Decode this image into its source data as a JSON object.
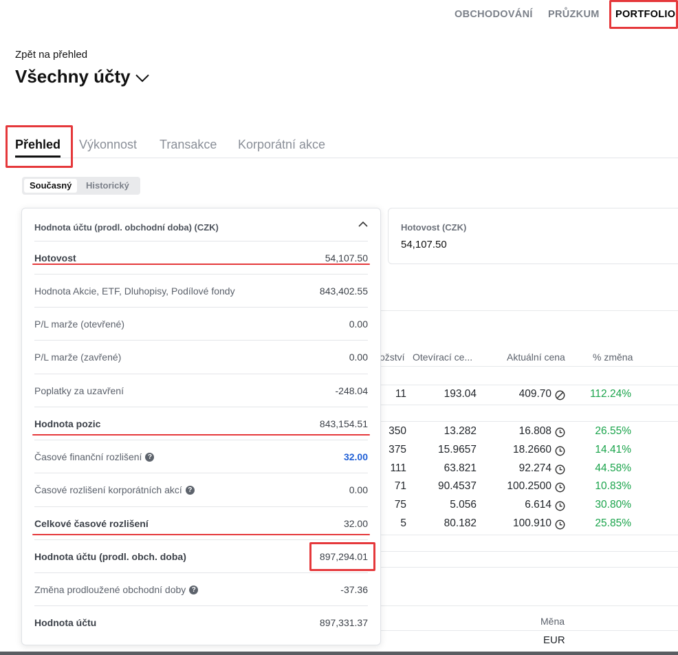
{
  "topnav": {
    "items": [
      {
        "label": "OBCHODOVÁNÍ"
      },
      {
        "label": "PRŮZKUM"
      },
      {
        "label": "PORTFOLIO"
      }
    ]
  },
  "header": {
    "back_link": "Zpět na přehled",
    "title": "Všechny účty"
  },
  "tabs": [
    {
      "label": "Přehled"
    },
    {
      "label": "Výkonnost"
    },
    {
      "label": "Transakce"
    },
    {
      "label": "Korporátní akce"
    }
  ],
  "segment": {
    "current": "Současný",
    "historic": "Historický"
  },
  "cash_card": {
    "label": "Hotovost (CZK)",
    "value": "54,107.50"
  },
  "popover": {
    "title": "Hodnota účtu (prodl. obchodní doba) (CZK)",
    "rows": [
      {
        "label": "Hotovost",
        "value": "54,107.50"
      },
      {
        "label": "Hodnota Akcie, ETF, Dluhopisy, Podílové fondy",
        "value": "843,402.55"
      },
      {
        "label": "P/L marže (otevřené)",
        "value": "0.00"
      },
      {
        "label": "P/L marže (zavřené)",
        "value": "0.00"
      },
      {
        "label": "Poplatky za uzavření",
        "value": "-248.04"
      },
      {
        "label": "Hodnota pozic",
        "value": "843,154.51"
      },
      {
        "label": "Časové finanční rozlišení",
        "value": "32.00"
      },
      {
        "label": "Časové rozlišení korporátních akcí",
        "value": "0.00"
      },
      {
        "label": "Celkové časové rozlišení",
        "value": "32.00"
      },
      {
        "label": "Hodnota účtu (prodl. obch. doba)",
        "value": "897,294.01"
      },
      {
        "label": "Změna prodloužené obchodní doby",
        "value": "-37.36"
      },
      {
        "label": "Hodnota účtu",
        "value": "897,331.37"
      }
    ]
  },
  "positions": {
    "headers": [
      "ožství",
      "Otevírací ce...",
      "Aktuální cena",
      "% změna"
    ],
    "rows": [
      {
        "qty": "11",
        "open": "193.04",
        "current": "409.70",
        "change": "112.24%",
        "status": "blocked-icon"
      },
      {
        "qty": "350",
        "open": "13.282",
        "current": "16.808",
        "change": "26.55%",
        "status": "clock-icon"
      },
      {
        "qty": "375",
        "open": "15.9657",
        "current": "18.2660",
        "change": "14.41%",
        "status": "clock-icon"
      },
      {
        "qty": "111",
        "open": "63.821",
        "current": "92.274",
        "change": "44.58%",
        "status": "clock-icon"
      },
      {
        "qty": "71",
        "open": "90.4537",
        "current": "100.2500",
        "change": "10.83%",
        "status": "clock-icon"
      },
      {
        "qty": "75",
        "open": "5.056",
        "current": "6.614",
        "change": "30.80%",
        "status": "clock-icon"
      },
      {
        "qty": "5",
        "open": "80.182",
        "current": "100.910",
        "change": "25.85%",
        "status": "clock-icon"
      }
    ]
  },
  "currency_table": {
    "header": "Měna",
    "value": "EUR"
  },
  "colors": {
    "highlight": "#e5383b",
    "positive": "#19a34a",
    "accent_blue": "#1f5fd6"
  }
}
